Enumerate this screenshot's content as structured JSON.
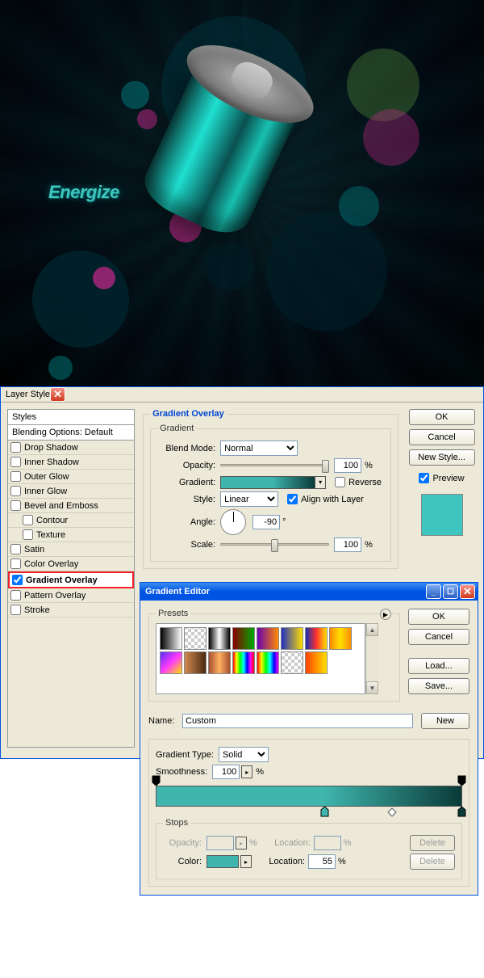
{
  "artwork": {
    "logo_text": "Energize"
  },
  "layer_style": {
    "title": "Layer Style",
    "styles_head": "Styles",
    "blending_options": "Blending Options: Default",
    "effects": [
      {
        "label": "Drop Shadow",
        "checked": false
      },
      {
        "label": "Inner Shadow",
        "checked": false
      },
      {
        "label": "Outer Glow",
        "checked": false
      },
      {
        "label": "Inner Glow",
        "checked": false
      },
      {
        "label": "Bevel and Emboss",
        "checked": false
      },
      {
        "label": "Contour",
        "checked": false,
        "indent": true
      },
      {
        "label": "Texture",
        "checked": false,
        "indent": true
      },
      {
        "label": "Satin",
        "checked": false
      },
      {
        "label": "Color Overlay",
        "checked": false
      },
      {
        "label": "Gradient Overlay",
        "checked": true,
        "selected": true,
        "bold": true
      },
      {
        "label": "Pattern Overlay",
        "checked": false
      },
      {
        "label": "Stroke",
        "checked": false
      }
    ],
    "section_title": "Gradient Overlay",
    "group_title": "Gradient",
    "blend_mode_label": "Blend Mode:",
    "blend_mode_value": "Normal",
    "opacity_label": "Opacity:",
    "opacity_value": "100",
    "opacity_pct": "%",
    "gradient_label": "Gradient:",
    "reverse_label": "Reverse",
    "style_label": "Style:",
    "style_value": "Linear",
    "align_label": "Align with Layer",
    "angle_label": "Angle:",
    "angle_value": "-90",
    "angle_deg": "°",
    "scale_label": "Scale:",
    "scale_value": "100",
    "scale_pct": "%",
    "ok": "OK",
    "cancel": "Cancel",
    "new_style": "New Style...",
    "preview": "Preview",
    "preview_color": "#3fc5bf"
  },
  "gradient_editor": {
    "title": "Gradient Editor",
    "presets_label": "Presets",
    "presets_play": "▶",
    "name_label": "Name:",
    "name_value": "Custom",
    "new_btn": "New",
    "ok": "OK",
    "cancel": "Cancel",
    "load": "Load...",
    "save": "Save...",
    "type_label": "Gradient Type:",
    "type_value": "Solid",
    "smooth_label": "Smoothness:",
    "smooth_value": "100",
    "smooth_pct": "%",
    "stops_label": "Stops",
    "stop_opacity_label": "Opacity:",
    "stop_opacity_pct": "%",
    "stop_loc_label": "Location:",
    "stop_loc_pct": "%",
    "stop_loc_value": "55",
    "delete": "Delete",
    "color_label": "Color:",
    "color_value": "#3fb5ad",
    "swatches": [
      "linear-gradient(90deg,#000,#fff)",
      "repeating-conic-gradient(#ccc 0 25%,#fff 0 50%) 0/8px 8px, linear-gradient(90deg,rgba(0,0,0,1),rgba(0,0,0,0))",
      "linear-gradient(90deg,#000,#fff,#000)",
      "linear-gradient(90deg,#8b0000,#00aa00)",
      "linear-gradient(90deg,#6a00b0,#ff8c00)",
      "linear-gradient(90deg,#2030c0,#ffe000)",
      "linear-gradient(90deg,#1030b0,#ff3030,#ffe000)",
      "linear-gradient(90deg,#ff8c00,#ffe000,#ff8c00)",
      "linear-gradient(135deg,#5a2fff,#ff3aff,#ffe000)",
      "linear-gradient(90deg,#d08a50,#4a2a10)",
      "linear-gradient(90deg,#a85030,#ffb060,#a85030)",
      "linear-gradient(90deg,#f00,#ff0,#0f0,#0ff,#00f,#f0f,#f00)",
      "linear-gradient(90deg,#f00,#ff0,#0f0,#0ff,#00f,#f0f)",
      "repeating-conic-gradient(#ccc 0 25%,#fff 0 50%) 0/8px 8px",
      "linear-gradient(90deg,#ff4000,#ffe000)"
    ],
    "gradient_stops": {
      "opacity_from": 100,
      "opacity_to": 100,
      "color_from": "#3fb5ad",
      "color_mid_loc": 55,
      "color_to": "#0a3a38"
    }
  }
}
